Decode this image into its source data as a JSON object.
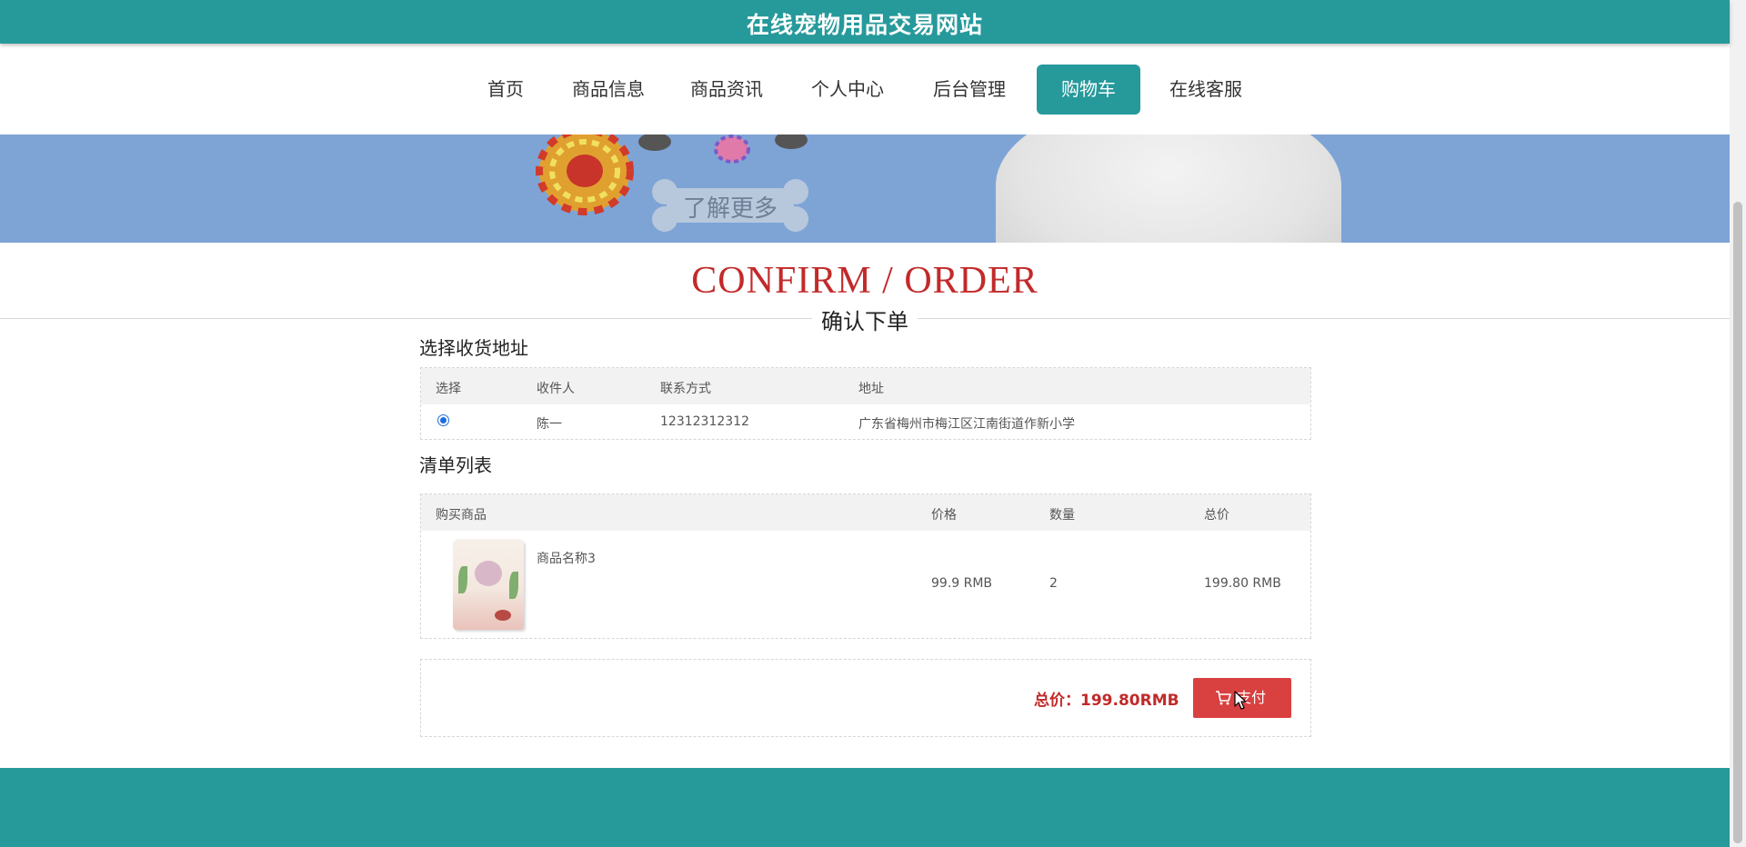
{
  "site": {
    "title": "在线宠物用品交易网站"
  },
  "nav": {
    "items": [
      {
        "label": "首页"
      },
      {
        "label": "商品信息"
      },
      {
        "label": "商品资讯"
      },
      {
        "label": "个人中心"
      },
      {
        "label": "后台管理"
      },
      {
        "label": "购物车"
      },
      {
        "label": "在线客服"
      }
    ],
    "active": "购物车"
  },
  "banner": {
    "button_label": "了解更多"
  },
  "heading": {
    "title": "CONFIRM / ORDER",
    "subtitle": "确认下单"
  },
  "address": {
    "section_label": "选择收货地址",
    "columns": [
      "选择",
      "收件人",
      "联系方式",
      "地址"
    ],
    "rows": [
      {
        "selected": true,
        "recipient": "陈一",
        "phone": "12312312312",
        "address": "广东省梅州市梅江区江南街道作新小学"
      }
    ]
  },
  "items": {
    "section_label": "清单列表",
    "columns": [
      "购买商品",
      "价格",
      "数量",
      "总价"
    ],
    "rows": [
      {
        "name": "商品名称3",
        "price": "99.9 RMB",
        "quantity": "2",
        "total": "199.80 RMB"
      }
    ]
  },
  "checkout": {
    "total_label": "总价：199.80RMB",
    "pay_label": "支付"
  },
  "colors": {
    "primary": "#26999b",
    "accent_red": "#c22a2a",
    "pay_button": "#d94040",
    "banner": "#7ea4d6"
  }
}
